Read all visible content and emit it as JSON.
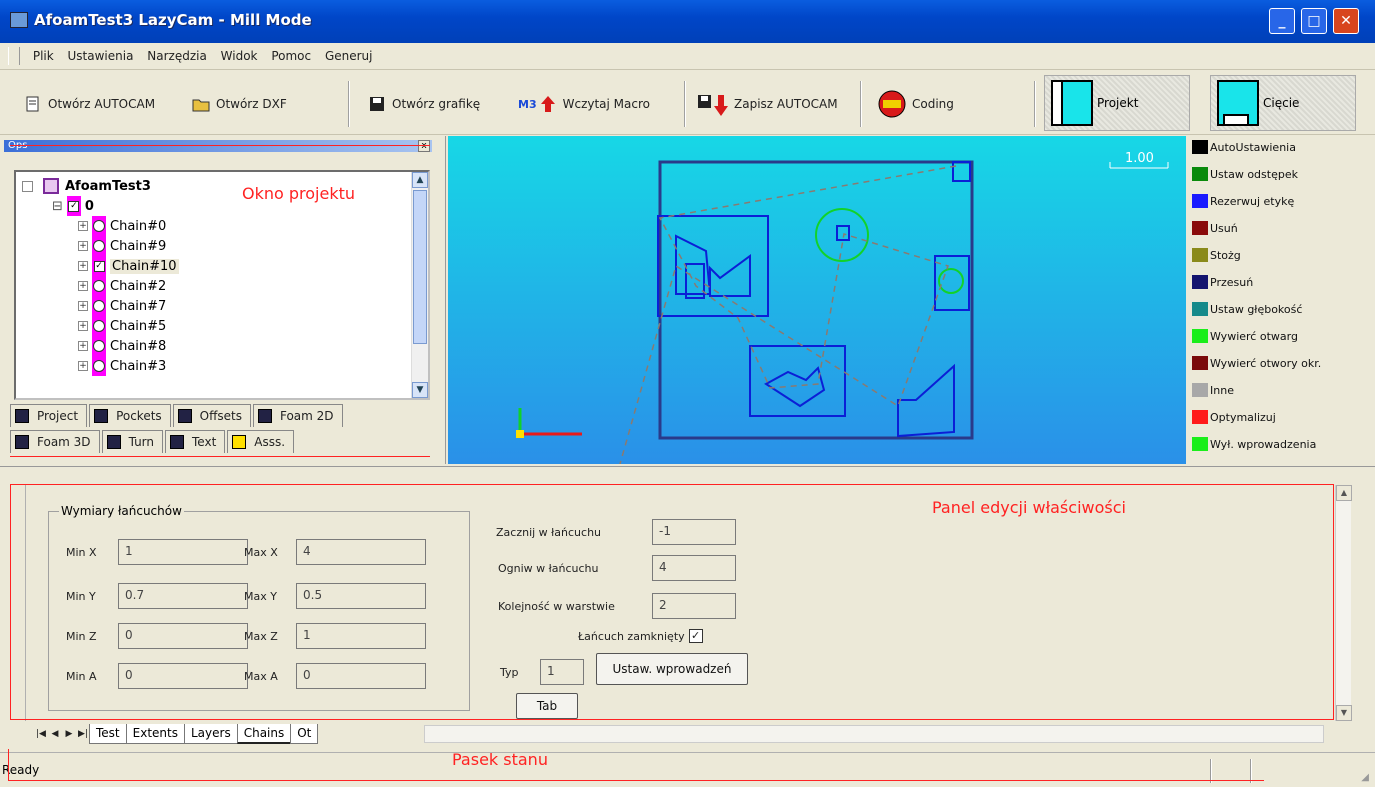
{
  "window": {
    "title": "AfoamTest3 LazyCam - Mill Mode",
    "buttons": {
      "minimize": "_",
      "maximize": "□",
      "close": "✕"
    }
  },
  "menu": [
    "Plik",
    "Ustawienia",
    "Narzędzia",
    "Widok",
    "Pomoc",
    "Generuj"
  ],
  "toolbar": {
    "open_autocam": "Otwórz AUTOCAM",
    "open_dxf": "Otwórz DXF",
    "save_graphics": "Otwórz grafikę",
    "load_macro": "Wczytaj Macro",
    "save_cam": "Zapisz AUTOCAM",
    "coding": "Coding",
    "project": "Projekt",
    "outline": "Cięcie",
    "m3_badge": "M3"
  },
  "project_panel": {
    "caption": "Ops",
    "annotation": "Okno projektu",
    "tree": {
      "root": "AfoamTest3",
      "layer": "0",
      "chains": [
        "Chain#0",
        "Chain#9",
        "Chain#10",
        "Chain#2",
        "Chain#7",
        "Chain#5",
        "Chain#8",
        "Chain#3"
      ],
      "selected_chain": "Chain#10"
    },
    "tabs_row1": [
      "Project",
      "Pockets",
      "Offsets",
      "Foam 2D"
    ],
    "tabs_row2": [
      "Foam 3D",
      "Turn",
      "Text",
      "Asss."
    ]
  },
  "viewport": {
    "scale_label": "1.00",
    "colors": {
      "bg_top": "#17d7e6",
      "bg_bottom": "#2a90e8",
      "geometry": "#0b1fd6",
      "frame": "#2a3a8a",
      "selected": "#12d22a",
      "path": "#8a7a70"
    }
  },
  "legend": [
    {
      "label": "AutoUstawienia",
      "color": "#000000"
    },
    {
      "label": "Ustaw odstępek",
      "color": "#0a8a0a"
    },
    {
      "label": "Rezerwuj etykę",
      "color": "#1a1aff"
    },
    {
      "label": "Usuń",
      "color": "#8a0a0a"
    },
    {
      "label": "Stożg",
      "color": "#8a8a1a"
    },
    {
      "label": "Przesuń",
      "color": "#14146e"
    },
    {
      "label": "Ustaw głębokość",
      "color": "#168a8a"
    },
    {
      "label": "Wywierć otwarg",
      "color": "#1aee1a"
    },
    {
      "label": "Wywierć otwory okr.",
      "color": "#7a0a0a"
    },
    {
      "label": "Inne",
      "color": "#a8a8a8"
    },
    {
      "label": "Optymalizuj",
      "color": "#ff1a1a"
    },
    {
      "label": "Wył. wprowadzenia",
      "color": "#1aee1a"
    }
  ],
  "properties": {
    "annotation": "Panel edycji właściwości",
    "group_title": "Wymiary łańcuchów",
    "fields": {
      "min_x": {
        "label": "Min X",
        "value": "1"
      },
      "max_x": {
        "label": "Max X",
        "value": "4"
      },
      "min_y": {
        "label": "Min Y",
        "value": "0.7"
      },
      "max_y": {
        "label": "Max Y",
        "value": "0.5"
      },
      "min_z": {
        "label": "Min Z",
        "value": "0"
      },
      "max_z": {
        "label": "Max Z",
        "value": "1"
      },
      "min_a": {
        "label": "Min A",
        "value": "0"
      },
      "max_a": {
        "label": "Max A",
        "value": "0"
      }
    },
    "right": {
      "start_label": "Zacznij w łańcuchu",
      "start_value": "-1",
      "end_label": "Ogniw w łańcuchu",
      "end_value": "4",
      "layers_label": "Kolejność w warstwie",
      "layers_value": "2",
      "closed_label": "Łańcuch zamknięty",
      "closed": true,
      "type_label": "Typ",
      "type_value": "1",
      "lead_button": "Ustaw. wprowadzeń",
      "tab_button": "Tab"
    },
    "sheet_tabs": [
      "Test",
      "Extents",
      "Layers",
      "Chains",
      "Ot"
    ],
    "active_sheet": "Chains"
  },
  "status": {
    "text": "Ready",
    "annotation": "Pasek stanu"
  }
}
